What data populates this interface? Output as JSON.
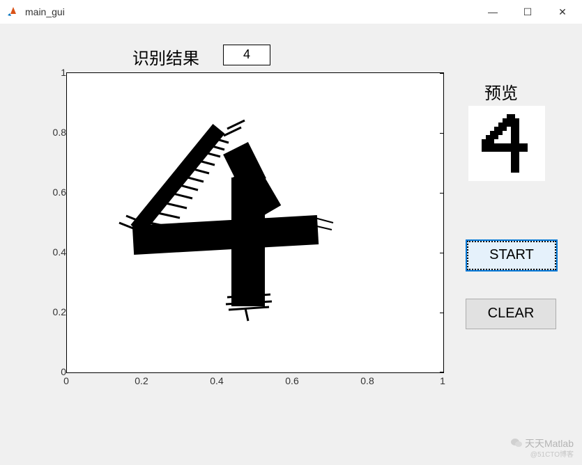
{
  "window": {
    "title": "main_gui",
    "min": "—",
    "max": "☐",
    "close": "✕"
  },
  "result": {
    "label": "识别结果",
    "value": "4"
  },
  "preview": {
    "label": "预览"
  },
  "buttons": {
    "start": "START",
    "clear": "CLEAR"
  },
  "chart_data": {
    "type": "scatter",
    "title": "",
    "xlabel": "",
    "ylabel": "",
    "xlim": [
      0,
      1
    ],
    "ylim": [
      0,
      1
    ],
    "xticks": [
      0,
      0.2,
      0.4,
      0.6,
      0.8,
      1
    ],
    "yticks": [
      0,
      0.2,
      0.4,
      0.6,
      0.8,
      1
    ],
    "strokes_description": "Hand-drawn digit '4' occupying approx x:[0.16,0.67], y:[0.20,0.82]; composed of thick brush marks: diagonal from (0.40,0.82) down-left to (0.16,0.47), horizontal bar from (0.17,0.43) to (0.67,0.47), vertical descender from (0.45,0.78) down to (0.45,0.21)."
  },
  "axis": {
    "xticks": [
      "0",
      "0.2",
      "0.4",
      "0.6",
      "0.8",
      "1"
    ],
    "yticks": [
      "0",
      "0.2",
      "0.4",
      "0.6",
      "0.8",
      "1"
    ]
  },
  "watermark": {
    "line1": "天天Matlab",
    "line2": "@51CTO博客"
  }
}
